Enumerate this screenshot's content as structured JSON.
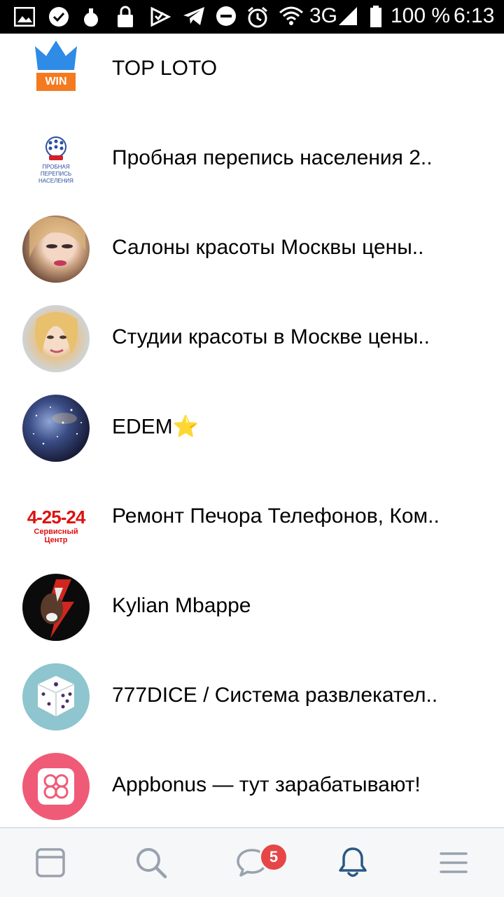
{
  "status_bar": {
    "network": "3G",
    "battery": "100 %",
    "time": "6:13"
  },
  "list": {
    "items": [
      {
        "title": "TOP LOTO",
        "logo_text": "WIN"
      },
      {
        "title": "Пробная перепись населения 2..",
        "logo_text": "ПРОБНАЯ ПЕРЕПИСЬ НАСЕЛЕНИЯ"
      },
      {
        "title": "Салоны красоты Москвы цены.."
      },
      {
        "title": "Студии красоты в Москве цены.."
      },
      {
        "title": "EDEM⭐"
      },
      {
        "title": "Ремонт Печора Телефонов, Ком..",
        "logo_text": "4-25-24",
        "logo_subtext": "Сервисный Центр"
      },
      {
        "title": "Kylian Mbappe"
      },
      {
        "title": "777DICE / Система развлекател.."
      },
      {
        "title": "Appbonus — тут зарабатывают!"
      }
    ]
  },
  "tab_bar": {
    "tabs": [
      {
        "icon": "news-icon",
        "active": false
      },
      {
        "icon": "search-icon",
        "active": false
      },
      {
        "icon": "messages-icon",
        "active": false,
        "badge": "5"
      },
      {
        "icon": "notifications-icon",
        "active": true
      },
      {
        "icon": "menu-icon",
        "active": false
      }
    ]
  },
  "colors": {
    "accent": "#2a5885",
    "inactive_icon": "#99a2ad",
    "badge": "#e64646"
  }
}
